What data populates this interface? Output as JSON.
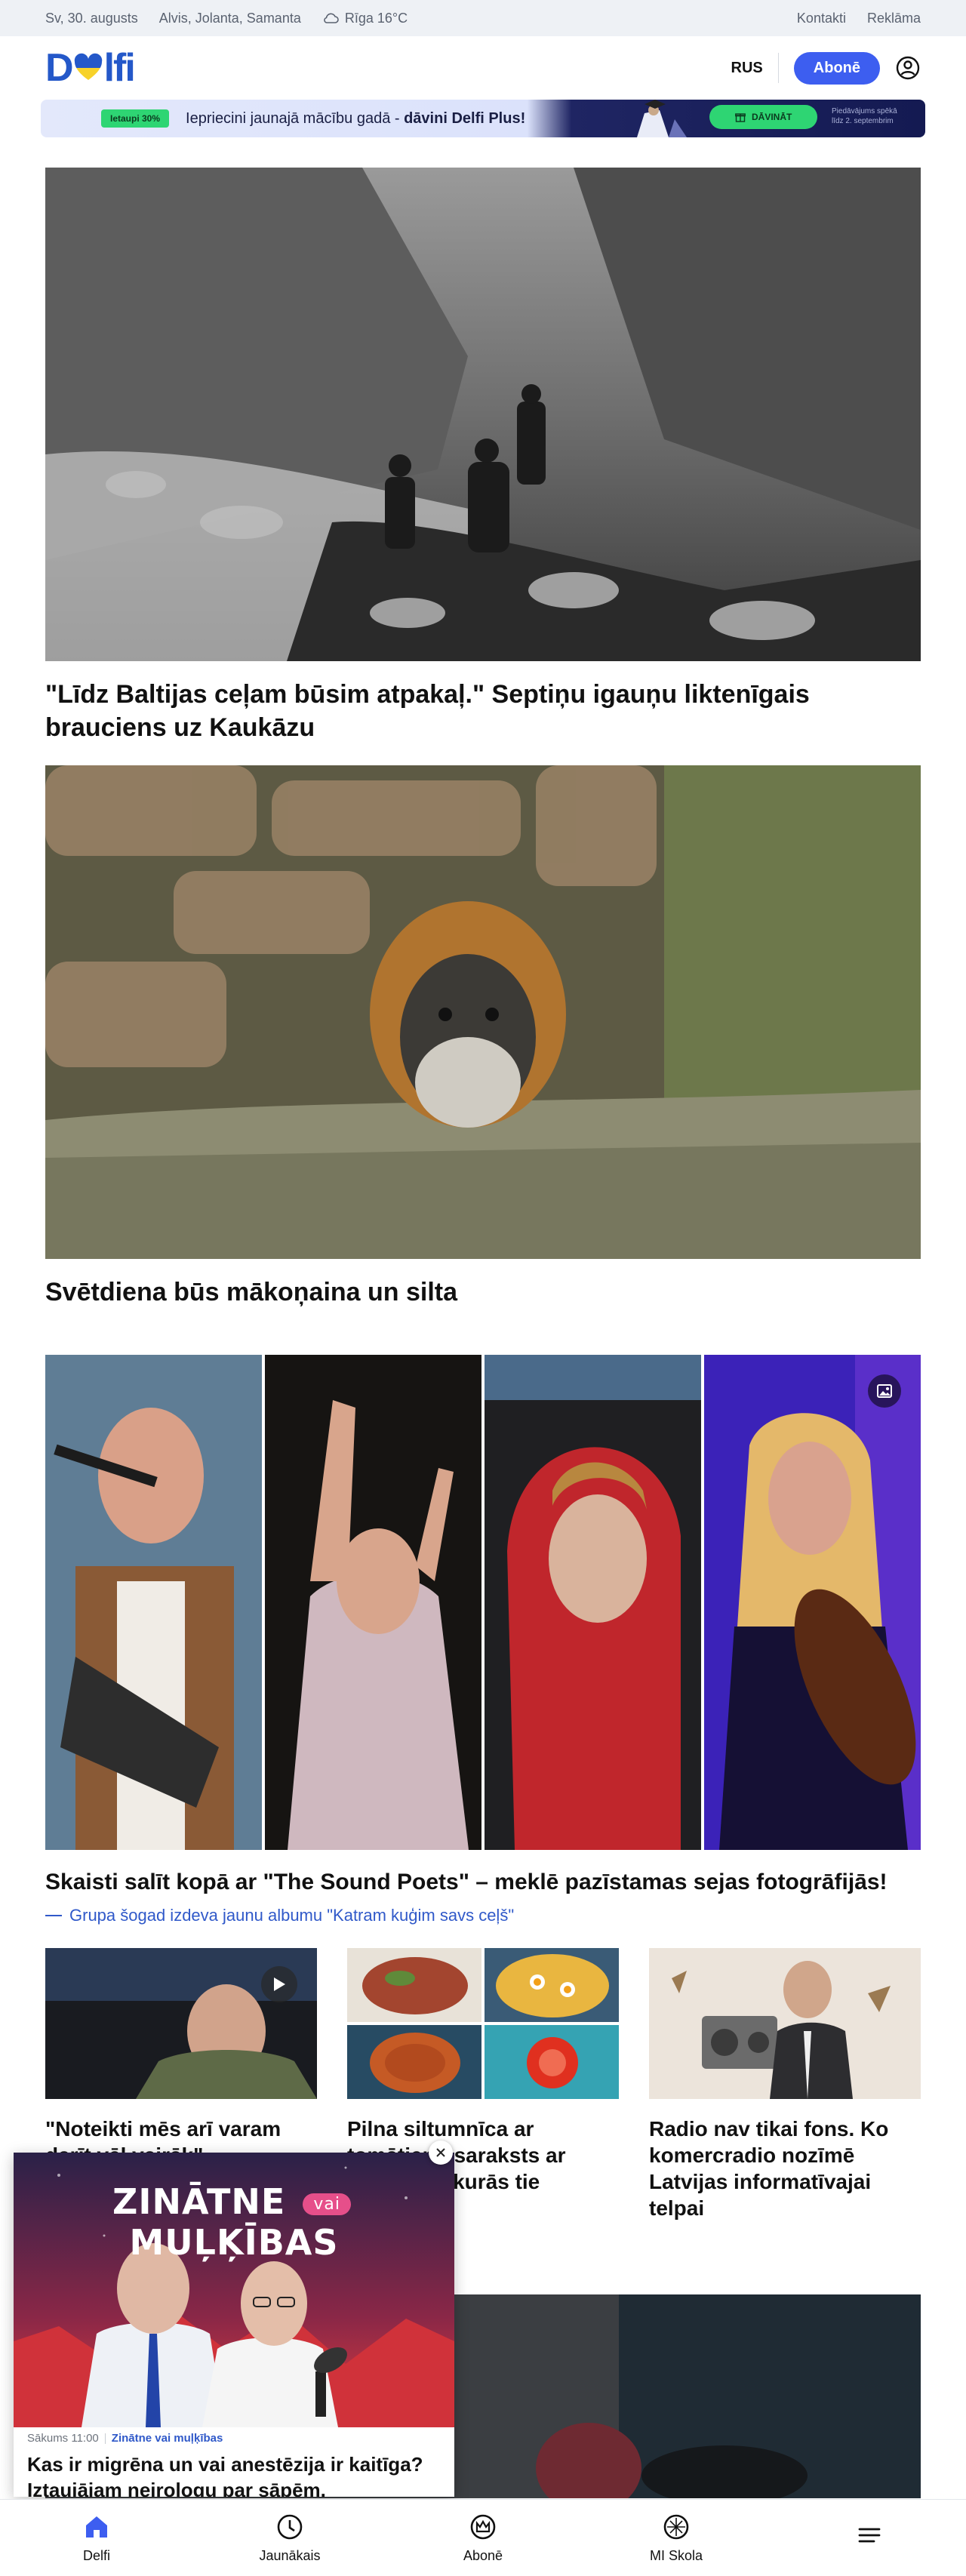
{
  "topbar": {
    "date": "Sv, 30. augusts",
    "namedays": "Alvis, Jolanta, Samanta",
    "weather": "Rīga 16°C",
    "links": [
      "Kontakti",
      "Reklāma"
    ]
  },
  "header": {
    "logo": "Delfi",
    "language": "RUS",
    "subscribe": "Abonē"
  },
  "promo": {
    "discount": "Ietaupi 30%",
    "text_pre": "Iepriecini jaunajā mācību gadā - ",
    "text_bold": "dāvini Delfi Plus!",
    "gift_button": "DĀVINĀT",
    "fine_print_1": "Piedāvājums spēkā",
    "fine_print_2": "līdz 2. septembrim"
  },
  "articles": [
    {
      "title": "\"Līdz Baltijas ceļam būsim atpakaļ.\" Septiņu igauņu liktenīgais brauciens uz Kaukāzu"
    },
    {
      "title": "Svētdiena būs mākoņaina un silta"
    }
  ],
  "gallery": {
    "title": "Skaisti salīt kopā ar \"The Sound Poets\" – meklē pazīstamas sejas fotogrāfijās!",
    "subtitle": "Grupa šogad izdeva jaunu albumu \"Katram kuģim savs ceļš\""
  },
  "cards": [
    {
      "title": "\"Noteikti mēs arī varam darīt vēl vairāk\" – militārais"
    },
    {
      "title": "Pilna siltumnīca ar tomātiem: saraksts ar receptēm, kurās tie noderēs"
    },
    {
      "title": "Radio nav tikai fons. Ko komercradio nozīmē Latvijas informatīvajai telpai"
    }
  ],
  "popup": {
    "art_title_1": "ZINĀTNE",
    "art_title_vai": "vai",
    "art_title_2": "MUĻĶĪBAS",
    "time": "Sākums 11:00",
    "category": "Zinātne vai muļķības",
    "title": "Kas ir migrēna un vai anestēzija ir kaitīga? Iztaujājam neirologu par sāpēm. Atkārtojums"
  },
  "bottom_nav": [
    {
      "label": "Delfi",
      "icon": "home-icon"
    },
    {
      "label": "Jaunākais",
      "icon": "clock-icon"
    },
    {
      "label": "Abonē",
      "icon": "crown-icon"
    },
    {
      "label": "MI Skola",
      "icon": "ai-icon"
    },
    {
      "label": "",
      "icon": "menu-icon"
    }
  ]
}
